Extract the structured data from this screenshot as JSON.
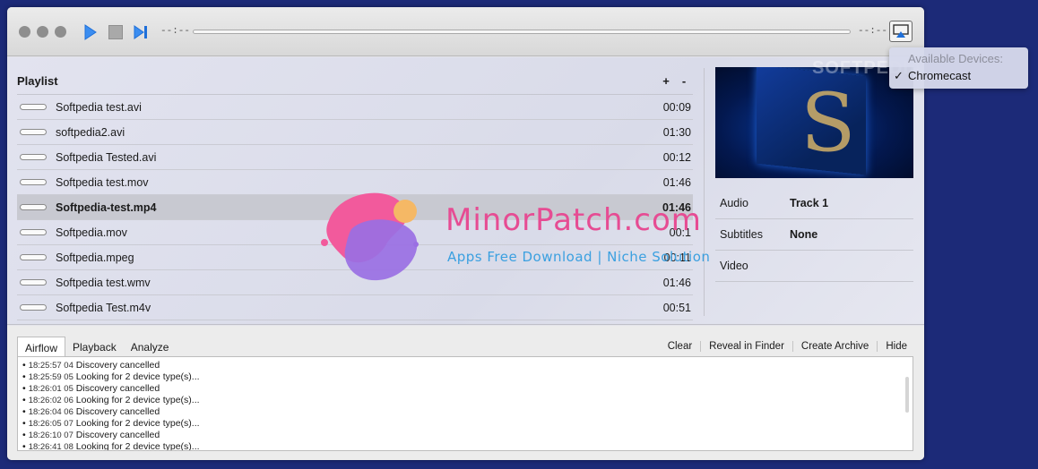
{
  "toolbar": {
    "time_elapsed": "--:--",
    "time_remaining": "--:--"
  },
  "playlist": {
    "title": "Playlist",
    "add_label": "+",
    "remove_label": "-",
    "items": [
      {
        "name": "Softpedia test.avi",
        "duration": "00:09"
      },
      {
        "name": "softpedia2.avi",
        "duration": "01:30"
      },
      {
        "name": "Softpedia Tested.avi",
        "duration": "00:12"
      },
      {
        "name": "Softpedia test.mov",
        "duration": "01:46"
      },
      {
        "name": "Softpedia-test.mp4",
        "duration": "01:46"
      },
      {
        "name": "Softpedia.mov",
        "duration": "00:1"
      },
      {
        "name": "Softpedia.mpeg",
        "duration": "00:11"
      },
      {
        "name": "Softpedia test.wmv",
        "duration": "01:46"
      },
      {
        "name": "Softpedia Test.m4v",
        "duration": "00:51"
      }
    ]
  },
  "info": {
    "audio_label": "Audio",
    "audio_value": "Track 1",
    "subtitles_label": "Subtitles",
    "subtitles_value": "None",
    "video_label": "Video",
    "video_value": ""
  },
  "bottom": {
    "tabs": [
      "Airflow",
      "Playback",
      "Analyze"
    ],
    "actions": [
      "Clear",
      "Reveal in Finder",
      "Create Archive",
      "Hide"
    ],
    "log": [
      {
        "stamp": "18:25:57 04",
        "text": "Discovery cancelled"
      },
      {
        "stamp": "18:25:59 05",
        "text": "Looking for 2 device type(s)..."
      },
      {
        "stamp": "18:26:01 05",
        "text": "Discovery cancelled"
      },
      {
        "stamp": "18:26:02 06",
        "text": "Looking for 2 device type(s)..."
      },
      {
        "stamp": "18:26:04 06",
        "text": "Discovery cancelled"
      },
      {
        "stamp": "18:26:05 07",
        "text": "Looking for 2 device type(s)..."
      },
      {
        "stamp": "18:26:10 07",
        "text": "Discovery cancelled"
      },
      {
        "stamp": "18:26:41 08",
        "text": "Looking for 2 device type(s)..."
      }
    ]
  },
  "devices": {
    "title": "Available Devices:",
    "check": "✓",
    "selected": "Chromecast"
  },
  "watermark": {
    "title": "MinorPatch.com",
    "subtitle": "Apps Free Download | Niche Solution",
    "softpedia": "SOFTPEDIA"
  },
  "colors": {
    "accent": "#1e6fd9",
    "desktop": "#1c2a78"
  }
}
